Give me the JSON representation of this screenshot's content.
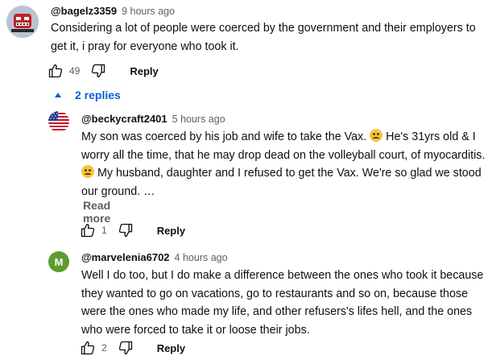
{
  "comments": [
    {
      "author": "@bagelz3359",
      "time": "9 hours ago",
      "text": "Considering a lot of people were coerced by the government and their employers to get it, i pray for everyone who took it.",
      "likes": "49",
      "reply_label": "Reply"
    }
  ],
  "replies_toggle": {
    "label": "2 replies",
    "color": "#065fd4"
  },
  "replies": [
    {
      "author": "@beckycraft2401",
      "time": "5 hours ago",
      "text_part1": "My son was coerced by his job and wife to take the Vax.",
      "text_part2": " He's 31yrs old & I worry all the time, that he may drop dead on the volleyball court, of myocarditis.",
      "text_part3": " My husband, daughter and I refused to get the Vax. We're so glad we stood our ground. …",
      "read_more": "Read more",
      "likes": "1",
      "reply_label": "Reply"
    },
    {
      "author": "@marvelenia6702",
      "time": "4 hours ago",
      "avatar_letter": "M",
      "avatar_color": "#5e9c2e",
      "text": "Well I do too, but I do make a difference between the ones who took it because they wanted to go on vacations, go to restaurants and so on, because those were the ones who made my life, and other refusers's lifes hell, and the ones who were forced to take it or loose their jobs.",
      "likes": "2",
      "reply_label": "Reply"
    }
  ]
}
